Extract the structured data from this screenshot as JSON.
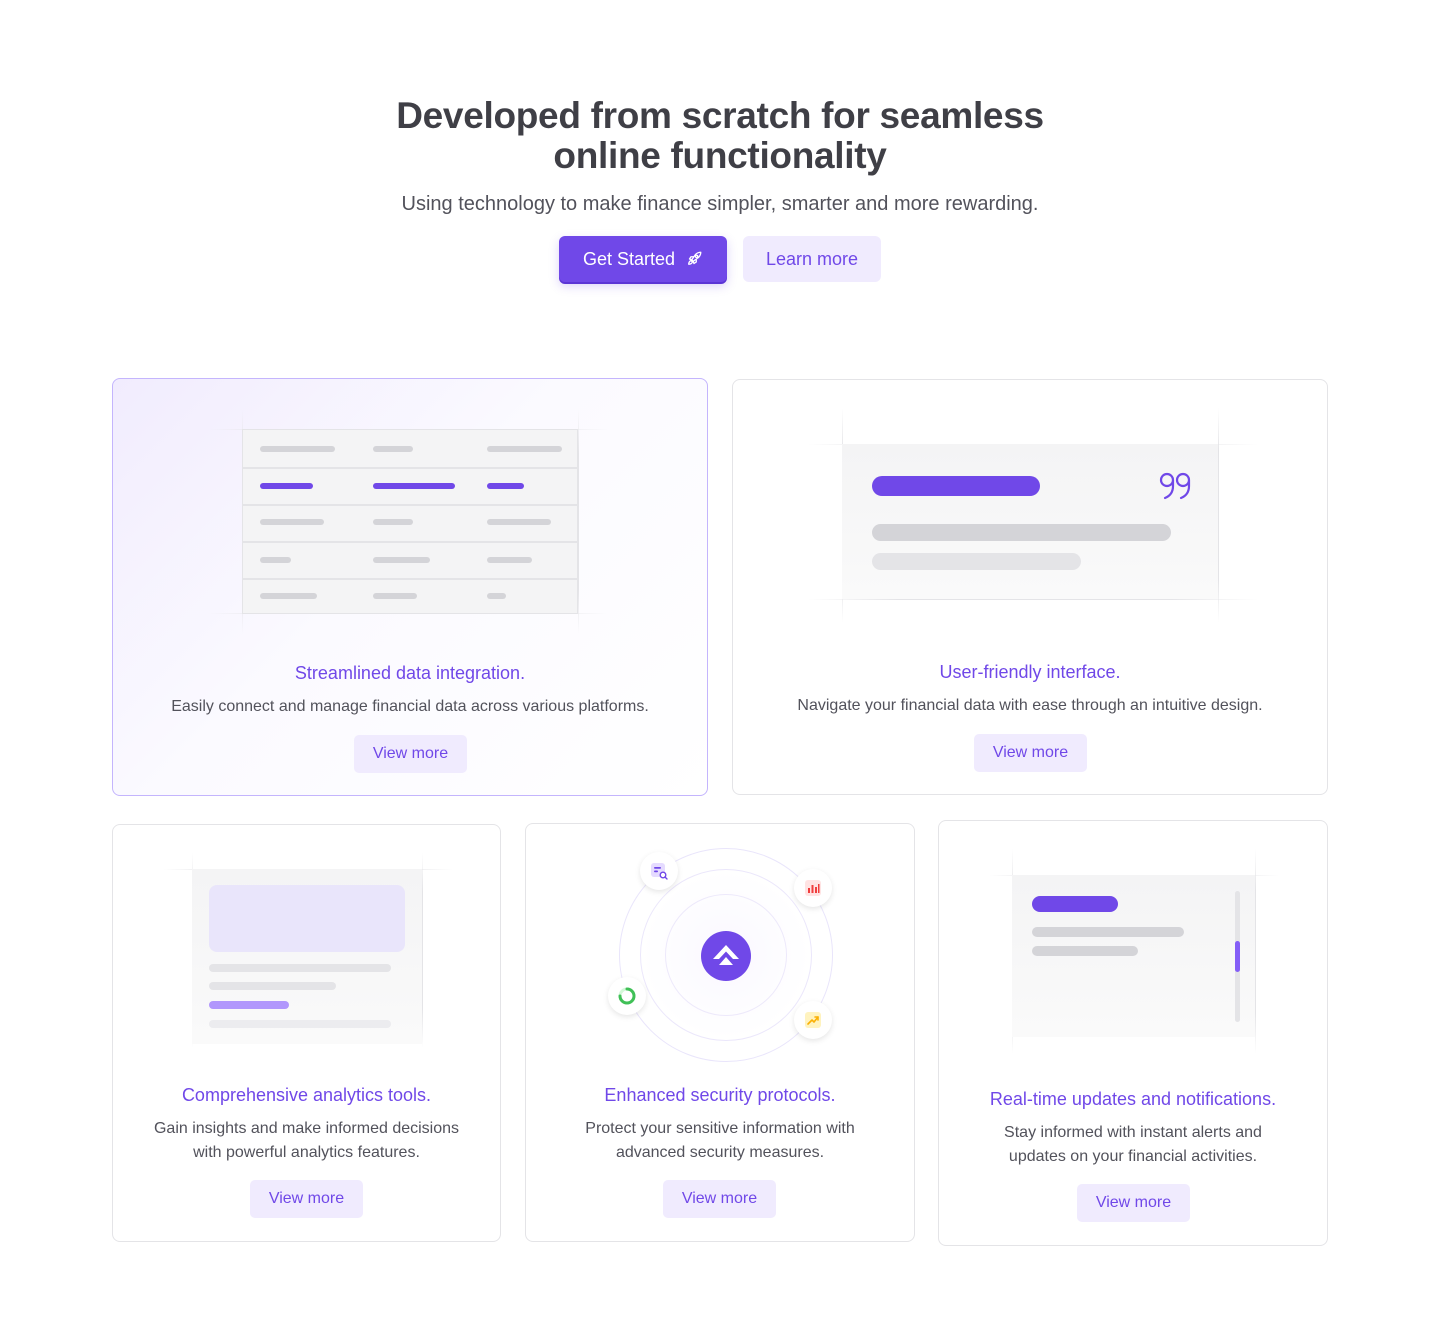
{
  "hero": {
    "title_line1": "Developed from scratch for seamless",
    "title_line2": "online functionality",
    "subtitle": "Using technology to make finance simpler, smarter and more rewarding.",
    "primary_button": "Get Started",
    "secondary_button": "Learn more"
  },
  "features": [
    {
      "title": "Streamlined data integration.",
      "description": "Easily connect and manage financial data across various platforms.",
      "cta": "View more"
    },
    {
      "title": "User-friendly interface.",
      "description": "Navigate your financial data with ease through an intuitive design.",
      "cta": "View more"
    },
    {
      "title": "Comprehensive analytics tools.",
      "description": "Gain insights and make informed decisions with powerful analytics features.",
      "cta": "View more"
    },
    {
      "title": "Enhanced security protocols.",
      "description": "Protect your sensitive information with advanced security measures.",
      "cta": "View more"
    },
    {
      "title": "Real-time updates and notifications.",
      "description": "Stay informed with instant alerts and updates on your financial activities.",
      "cta": "View more"
    }
  ],
  "colors": {
    "accent": "#7048e8",
    "accent_soft": "#f0ebfe",
    "text": "#3f3f46"
  },
  "icons": [
    "rocket-icon",
    "quote-icon",
    "search-doc-icon",
    "bar-chart-icon",
    "pie-chart-icon",
    "trend-up-icon",
    "brand-logo-icon"
  ]
}
